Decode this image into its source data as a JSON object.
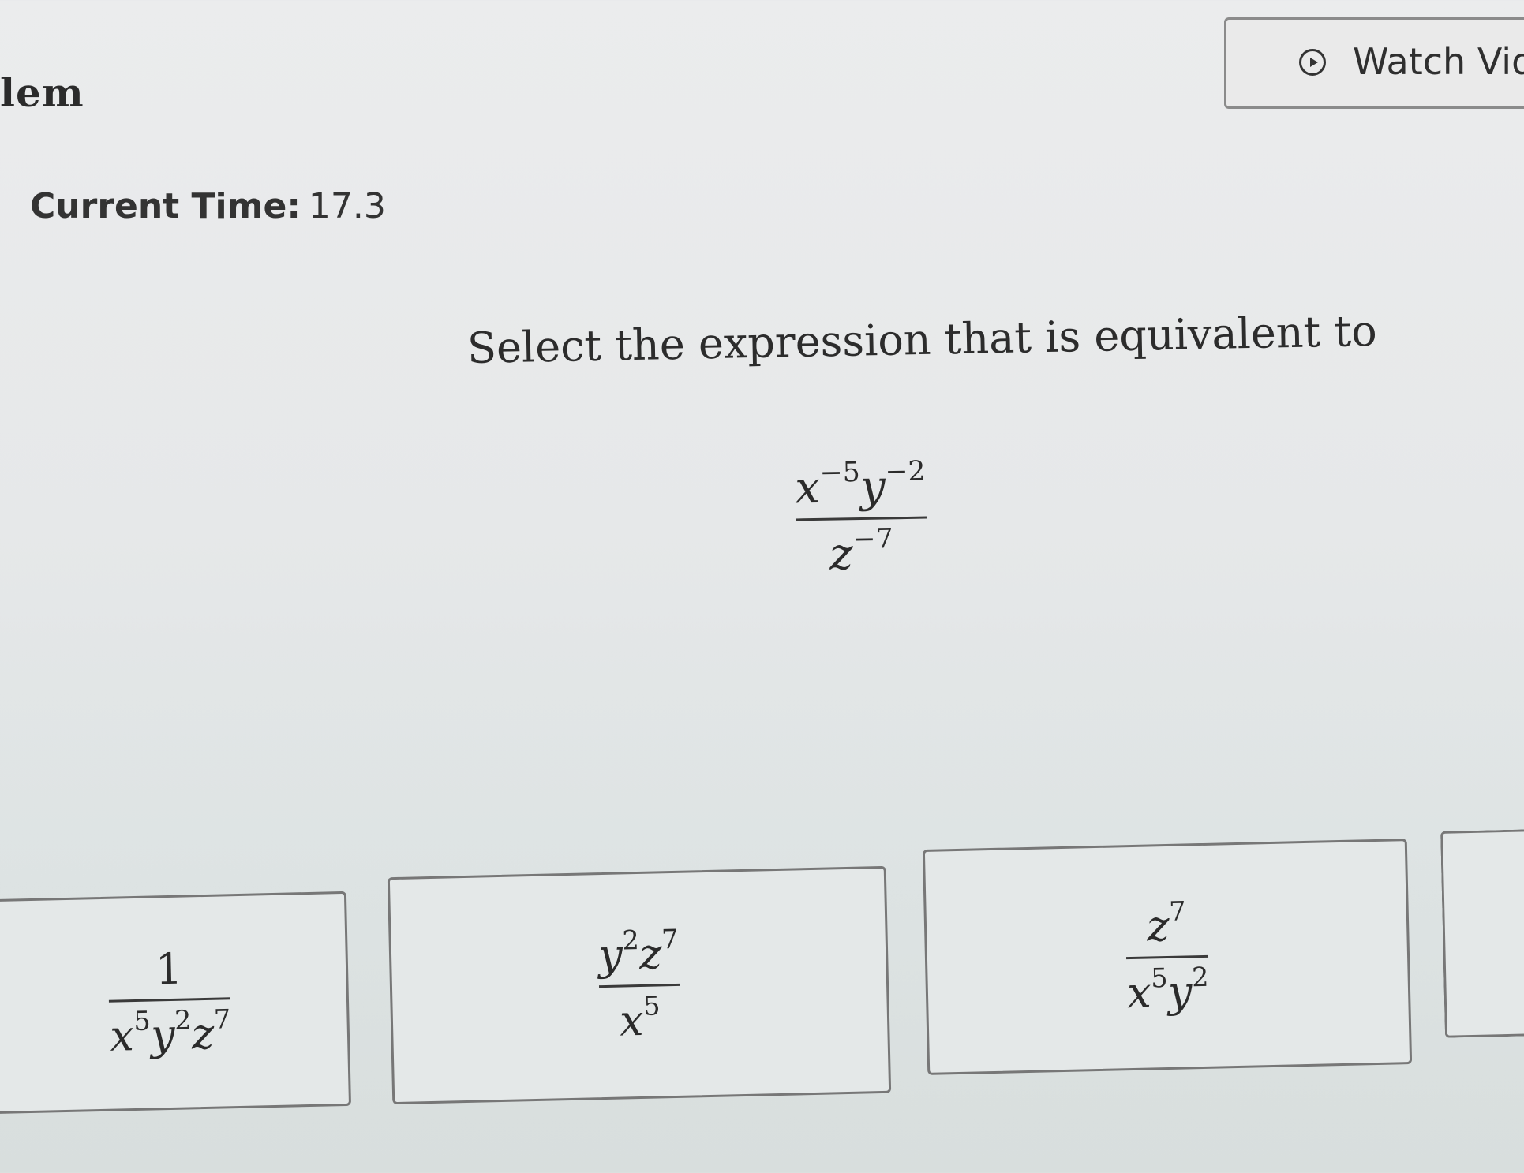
{
  "header": {
    "title_fragment": "lem",
    "watch_video_label": "Watch Vide",
    "watch_video_icon": "play-circle-icon"
  },
  "timer": {
    "label": "Current Time:",
    "value": "17.3"
  },
  "question": {
    "prompt": "Select the expression that is equivalent to",
    "expression": {
      "num_x_base": "x",
      "num_x_exp": "−5",
      "num_y_base": "y",
      "num_y_exp": "−2",
      "den_z_base": "z",
      "den_z_exp": "−7"
    }
  },
  "options": [
    {
      "numerator": "1",
      "den_x": "x",
      "den_x_exp": "5",
      "den_y": "y",
      "den_y_exp": "2",
      "den_z": "z",
      "den_z_exp": "7"
    },
    {
      "num_y": "y",
      "num_y_exp": "2",
      "num_z": "z",
      "num_z_exp": "7",
      "den_x": "x",
      "den_x_exp": "5"
    },
    {
      "num_z": "z",
      "num_z_exp": "7",
      "den_x": "x",
      "den_x_exp": "5",
      "den_y": "y",
      "den_y_exp": "2"
    },
    {}
  ]
}
